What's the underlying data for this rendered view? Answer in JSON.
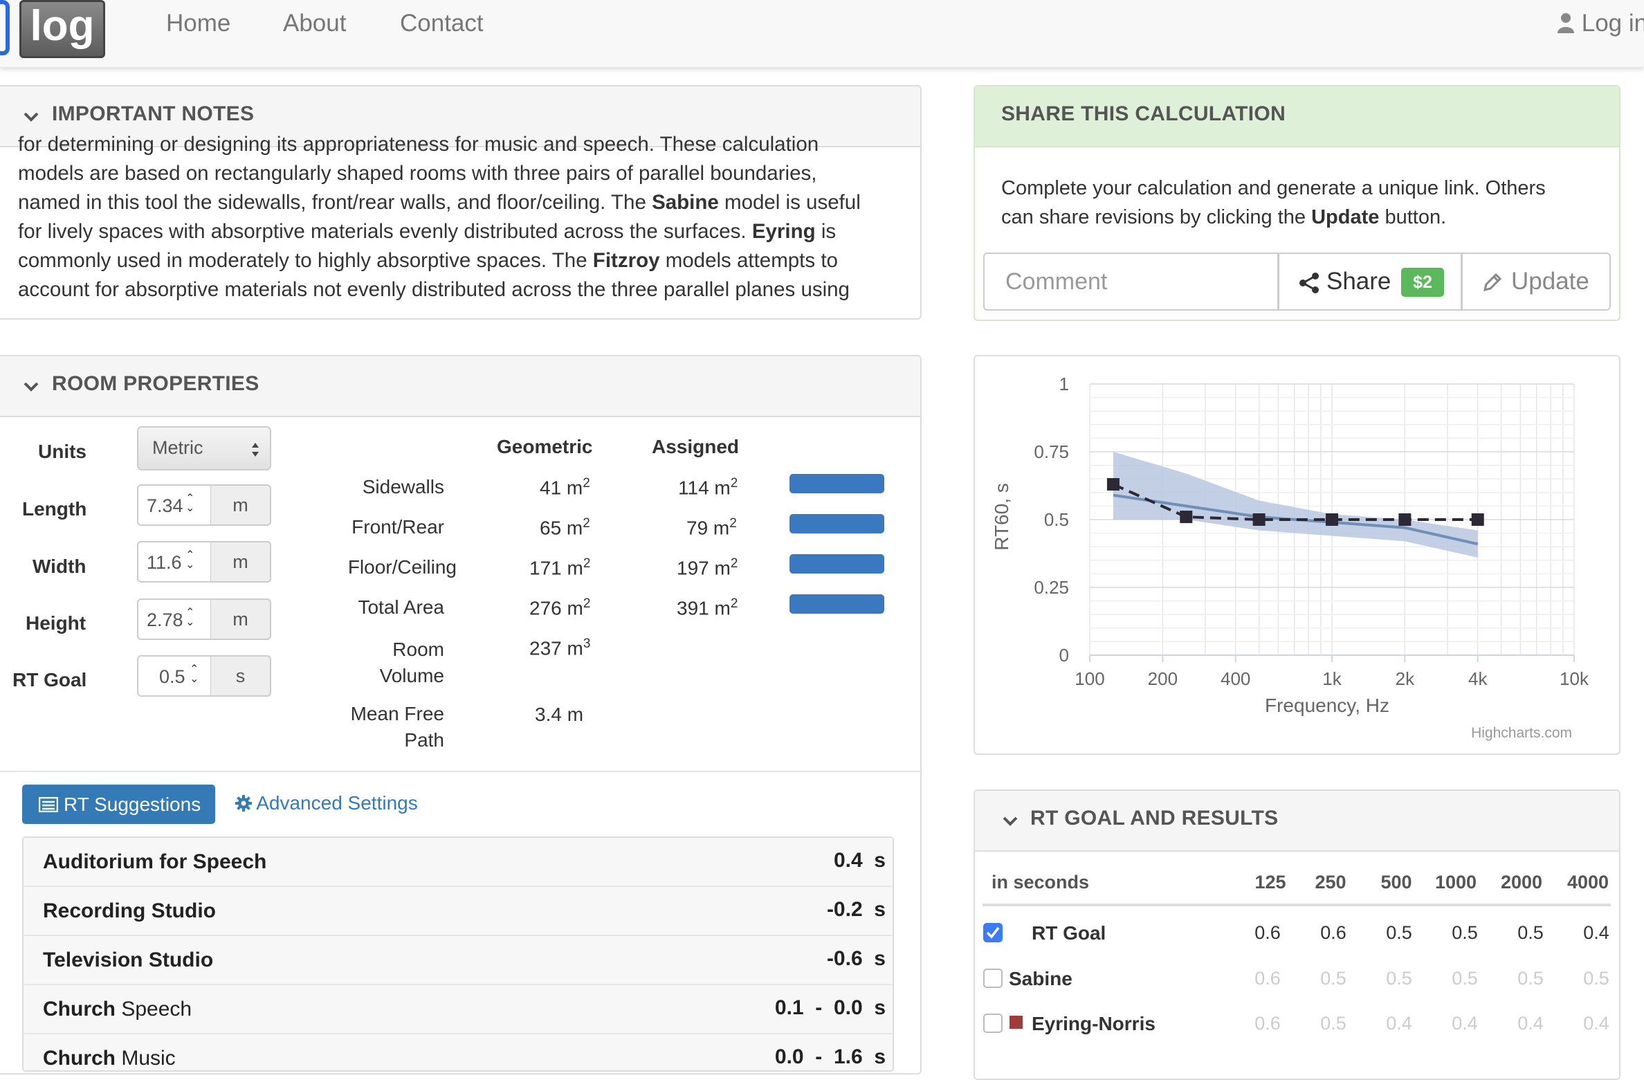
{
  "nav": {
    "logo_text": "log",
    "links": [
      "Home",
      "About",
      "Contact"
    ],
    "login": "Log in"
  },
  "notes": {
    "title": "IMPORTANT NOTES",
    "line0": "for determining or designing its appropriateness for music and speech. These calculation",
    "line1": "models are based on rectangularly shaped rooms with three pairs of parallel boundaries,",
    "line2a": "named in this tool the sidewalls, front/rear walls, and floor/ceiling. The ",
    "line2b": "Sabine",
    "line2c": " model is useful",
    "line3a": "for lively spaces with absorptive materials evenly distributed across the surfaces. ",
    "line3b": "Eyring",
    "line3c": " is",
    "line4a": "commonly used in moderately to highly absorptive spaces. The ",
    "line4b": "Fitzroy",
    "line4c": " models attempts to",
    "line5": "account for absorptive materials not evenly distributed across the three parallel planes using"
  },
  "room": {
    "title": "ROOM PROPERTIES",
    "units_label": "Units",
    "units_value": "Metric",
    "length_label": "Length",
    "length_value": "7.34",
    "length_unit": "m",
    "width_label": "Width",
    "width_value": "11.6",
    "width_unit": "m",
    "height_label": "Height",
    "height_value": "2.78",
    "height_unit": "m",
    "rtgoal_label": "RT Goal",
    "rtgoal_value": "0.5",
    "rtgoal_unit": "s",
    "col_geometric": "Geometric",
    "col_assigned": "Assigned",
    "rows": [
      {
        "label": "Sidewalls",
        "geo": "41 m",
        "geo_exp": "2",
        "asg": "114 m",
        "asg_exp": "2"
      },
      {
        "label": "Front/Rear",
        "geo": "65 m",
        "geo_exp": "2",
        "asg": "79 m",
        "asg_exp": "2"
      },
      {
        "label": "Floor/Ceiling",
        "geo": "171 m",
        "geo_exp": "2",
        "asg": "197 m",
        "asg_exp": "2"
      },
      {
        "label": "Total Area",
        "geo": "276 m",
        "geo_exp": "2",
        "asg": "391 m",
        "asg_exp": "2"
      }
    ],
    "volume_label_1": "Room",
    "volume_label_2": "Volume",
    "volume_value": "237 m",
    "volume_exp": "3",
    "mfp_label_1": "Mean Free",
    "mfp_label_2": "Path",
    "mfp_value": "3.4 m"
  },
  "tabs": {
    "rt_suggestions": "RT Suggestions",
    "advanced_settings": "Advanced Settings"
  },
  "suggestions": [
    {
      "bold": "Auditorium for Speech",
      "rest": "",
      "value": "0.4  s"
    },
    {
      "bold": "Recording Studio",
      "rest": "",
      "value": "-0.2  s"
    },
    {
      "bold": "Television Studio",
      "rest": "",
      "value": "-0.6  s"
    },
    {
      "bold": "Church",
      "rest": " Speech",
      "value": "0.1  -  0.0  s"
    },
    {
      "bold": "Church",
      "rest": " Music",
      "value": "0.0  -  1.6  s"
    }
  ],
  "share": {
    "title": "SHARE THIS CALCULATION",
    "text1": "Complete your calculation and generate a unique link. Others",
    "text2a": "can share revisions by clicking the ",
    "text2b": "Update",
    "text2c": " button.",
    "comment_placeholder": "Comment",
    "share_label": "Share",
    "badge": "$2",
    "update_label": "Update"
  },
  "chart_data": {
    "type": "line",
    "title": "",
    "xlabel": "Frequency, Hz",
    "ylabel": "RT60, s",
    "x_scale": "log",
    "xlim": [
      100,
      10000
    ],
    "ylim": [
      0,
      1
    ],
    "x_ticks": [
      100,
      200,
      400,
      1000,
      2000,
      4000,
      10000
    ],
    "x_tick_labels": [
      "100",
      "200",
      "400",
      "1k",
      "2k",
      "4k",
      "10k"
    ],
    "y_ticks": [
      0,
      0.25,
      0.5,
      0.75,
      1
    ],
    "y_tick_labels": [
      "0",
      "0.25",
      "0.5",
      "0.75",
      "1"
    ],
    "grid": true,
    "credits": "Highcharts.com",
    "series": [
      {
        "style": "band",
        "x": [
          125,
          250,
          500,
          1000,
          2000,
          4000
        ],
        "low": [
          0.5,
          0.5,
          0.46,
          0.44,
          0.42,
          0.36
        ],
        "high": [
          0.75,
          0.67,
          0.57,
          0.52,
          0.5,
          0.46
        ]
      },
      {
        "style": "line",
        "x": [
          125,
          250,
          500,
          1000,
          2000,
          4000
        ],
        "values": [
          0.59,
          0.55,
          0.51,
          0.49,
          0.47,
          0.41
        ]
      },
      {
        "style": "dashed-markers",
        "x": [
          125,
          250,
          500,
          1000,
          2000,
          4000
        ],
        "values": [
          0.63,
          0.51,
          0.5,
          0.5,
          0.5,
          0.5
        ]
      }
    ],
    "colors": {
      "band": "#b7c7e0",
      "line": "#6f8fb8",
      "goal": "#2d2836",
      "grid": "#e6e6e6"
    }
  },
  "results": {
    "title": "RT GOAL AND RESULTS",
    "unit_header": "in seconds",
    "freqs": [
      "125",
      "250",
      "500",
      "1000",
      "2000",
      "4000"
    ],
    "rows": [
      {
        "name": "RT Goal",
        "checked": true,
        "values": [
          "0.6",
          "0.6",
          "0.5",
          "0.5",
          "0.5",
          "0.4"
        ]
      },
      {
        "name": "Sabine",
        "checked": false,
        "values": [
          "0.6",
          "0.5",
          "0.5",
          "0.5",
          "0.5",
          "0.5"
        ]
      },
      {
        "name": "Eyring-Norris",
        "checked": false,
        "values": [
          "0.6",
          "0.5",
          "0.4",
          "0.4",
          "0.4",
          "0.4"
        ]
      }
    ],
    "eyring_color": "#a33a3a"
  }
}
